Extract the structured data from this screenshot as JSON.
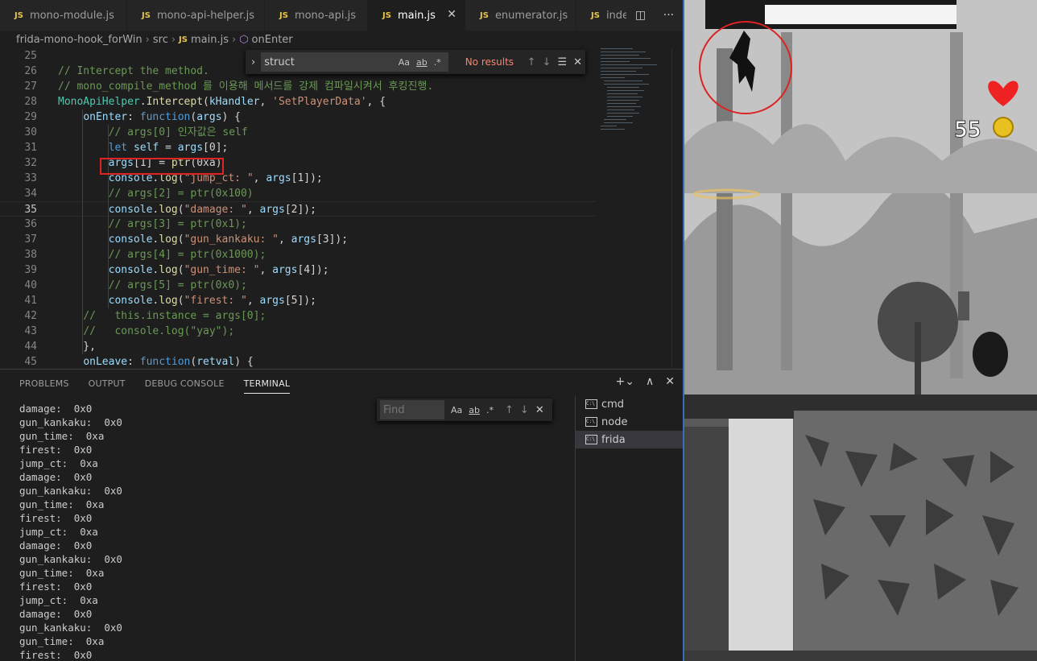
{
  "editor": {
    "tabs": [
      {
        "label": "mono-module.js",
        "icon": "js-icon"
      },
      {
        "label": "mono-api-helper.js",
        "icon": "js-icon"
      },
      {
        "label": "mono-api.js",
        "icon": "js-icon"
      },
      {
        "label": "main.js",
        "icon": "js-icon",
        "active": true
      },
      {
        "label": "enumerator.js",
        "icon": "js-icon"
      },
      {
        "label": "index.",
        "icon": "js-icon"
      }
    ],
    "breadcrumb": [
      "frida-mono-hook_forWin",
      "src",
      "main.js",
      "onEnter"
    ],
    "find": {
      "value": "struct",
      "status": "No results",
      "opts": [
        "Aa",
        "ab",
        ".*"
      ]
    },
    "lines": [
      {
        "n": "25",
        "t": ""
      },
      {
        "n": "26",
        "t": "// Intercept the method."
      },
      {
        "n": "27",
        "t": "// mono_compile_method 를 이용해 메서드를 강제 컴파일시켜서 후킹진행."
      },
      {
        "n": "28",
        "t": "MonoApiHelper.Intercept(kHandler, 'SetPlayerData', {"
      },
      {
        "n": "29",
        "t": "    onEnter: function(args) {"
      },
      {
        "n": "30",
        "t": "        // args[0] 인자값은 self"
      },
      {
        "n": "31",
        "t": "        let self = args[0];"
      },
      {
        "n": "32",
        "t": "        args[1] = ptr(0xa)"
      },
      {
        "n": "33",
        "t": "        console.log(\"jump_ct: \", args[1]);"
      },
      {
        "n": "34",
        "t": "        // args[2] = ptr(0x100)"
      },
      {
        "n": "35",
        "t": "        console.log(\"damage: \", args[2]);"
      },
      {
        "n": "36",
        "t": "        // args[3] = ptr(0x1);"
      },
      {
        "n": "37",
        "t": "        console.log(\"gun_kankaku: \", args[3]);"
      },
      {
        "n": "38",
        "t": "        // args[4] = ptr(0x1000);"
      },
      {
        "n": "39",
        "t": "        console.log(\"gun_time: \", args[4]);"
      },
      {
        "n": "40",
        "t": "        // args[5] = ptr(0x0);"
      },
      {
        "n": "41",
        "t": "        console.log(\"firest: \", args[5]);"
      },
      {
        "n": "42",
        "t": "    //   this.instance = args[0];"
      },
      {
        "n": "43",
        "t": "    //   console.log(\"yay\");"
      },
      {
        "n": "44",
        "t": "    },"
      },
      {
        "n": "45",
        "t": "    onLeave: function(retval) {"
      }
    ]
  },
  "panel": {
    "tabs": [
      "PROBLEMS",
      "OUTPUT",
      "DEBUG CONSOLE",
      "TERMINAL"
    ],
    "active_tab": "TERMINAL",
    "find_placeholder": "Find",
    "terminal_lines": [
      "damage:  0x0",
      "gun_kankaku:  0x0",
      "gun_time:  0xa",
      "firest:  0x0",
      "jump_ct:  0xa",
      "damage:  0x0",
      "gun_kankaku:  0x0",
      "gun_time:  0xa",
      "firest:  0x0",
      "jump_ct:  0xa",
      "damage:  0x0",
      "gun_kankaku:  0x0",
      "gun_time:  0xa",
      "firest:  0x0",
      "jump_ct:  0xa",
      "damage:  0x0",
      "gun_kankaku:  0x0",
      "gun_time:  0xa",
      "firest:  0x0"
    ],
    "terminals": [
      "cmd",
      "node",
      "frida"
    ],
    "active_terminal": "frida"
  },
  "game": {
    "score": "55",
    "colors": {
      "heart": "#ee2222",
      "circle": "#dd2222",
      "coin": "#e8c020",
      "frame": "#3b6fb4"
    }
  }
}
